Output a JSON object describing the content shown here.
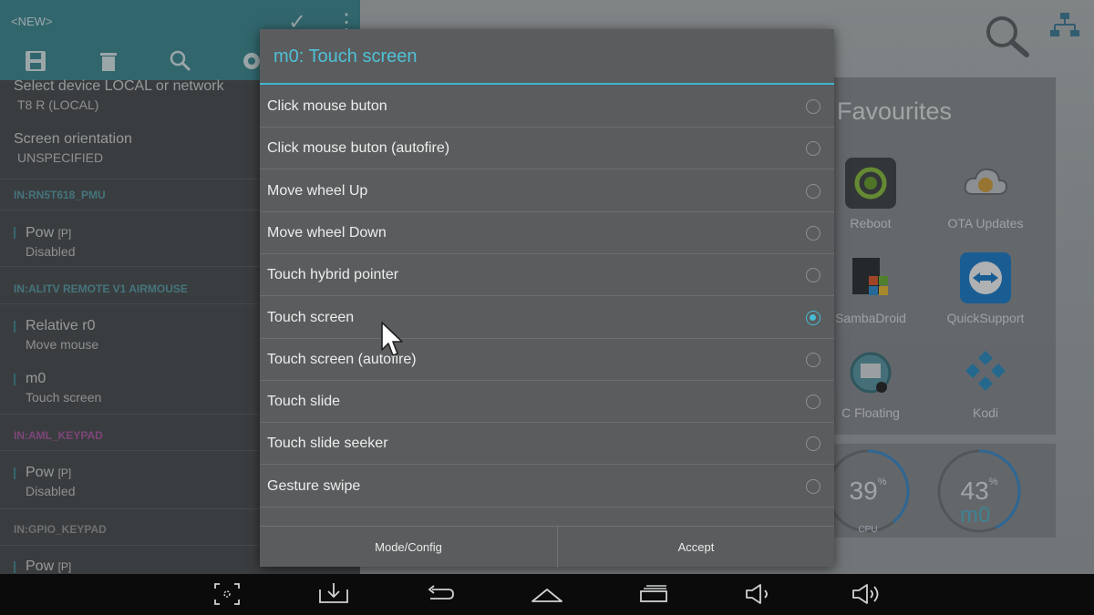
{
  "left_panel": {
    "title": "<NEW>",
    "settings": [
      {
        "title": "Select device LOCAL or network",
        "value": "T8 R (LOCAL)"
      },
      {
        "title": "Screen orientation",
        "value": "UNSPECIFIED"
      }
    ],
    "sections": [
      {
        "header": "IN:RN5T618_PMU",
        "items": [
          {
            "title": "Pow",
            "tag": "[P]",
            "value": "Disabled"
          }
        ]
      },
      {
        "header": "IN:ALITV REMOTE V1 AIRMOUSE",
        "items": [
          {
            "title": "Relative r0",
            "value": "Move mouse"
          },
          {
            "title": "m0",
            "value": "Touch screen"
          }
        ]
      },
      {
        "header": "IN:AML_KEYPAD",
        "items": [
          {
            "title": "Pow",
            "tag": "[P]",
            "value": "Disabled"
          }
        ]
      },
      {
        "header": "IN:GPIO_KEYPAD",
        "items": [
          {
            "title": "Pow",
            "tag": "[P]"
          }
        ]
      }
    ]
  },
  "dialog": {
    "title": "m0: Touch screen",
    "options": [
      {
        "label": "Click mouse buton",
        "checked": false
      },
      {
        "label": "Click mouse buton (autofire)",
        "checked": false
      },
      {
        "label": "Move wheel Up",
        "checked": false
      },
      {
        "label": "Move wheel Down",
        "checked": false
      },
      {
        "label": "Touch hybrid pointer",
        "checked": false
      },
      {
        "label": "Touch screen",
        "checked": true
      },
      {
        "label": "Touch screen (autofire)",
        "checked": false
      },
      {
        "label": "Touch slide",
        "checked": false
      },
      {
        "label": "Touch slide seeker",
        "checked": false
      },
      {
        "label": "Gesture swipe",
        "checked": false
      }
    ],
    "buttons": {
      "mode_config": "Mode/Config",
      "accept": "Accept"
    }
  },
  "launcher": {
    "favourites_title": "Favourites",
    "apps": [
      {
        "label": "Reboot",
        "icon": "reboot-icon"
      },
      {
        "label": "OTA Updates",
        "icon": "ota-cloud-icon"
      },
      {
        "label": "SambaDroid",
        "icon": "sambadroid-icon"
      },
      {
        "label": "QuickSupport",
        "icon": "teamviewer-icon"
      },
      {
        "label": "C Floating",
        "icon": "c-floating-icon"
      },
      {
        "label": "Kodi",
        "icon": "kodi-icon"
      }
    ],
    "gauges": [
      {
        "value": "39",
        "unit": "%",
        "label": "CPU",
        "fraction": 0.39
      },
      {
        "value": "43",
        "unit": "%",
        "fraction": 0.43
      }
    ],
    "overlay_text": "m0"
  },
  "colors": {
    "accent": "#3fb6cf",
    "topbar": "#3c8c96",
    "dialog_bg": "#5b5c5d"
  }
}
